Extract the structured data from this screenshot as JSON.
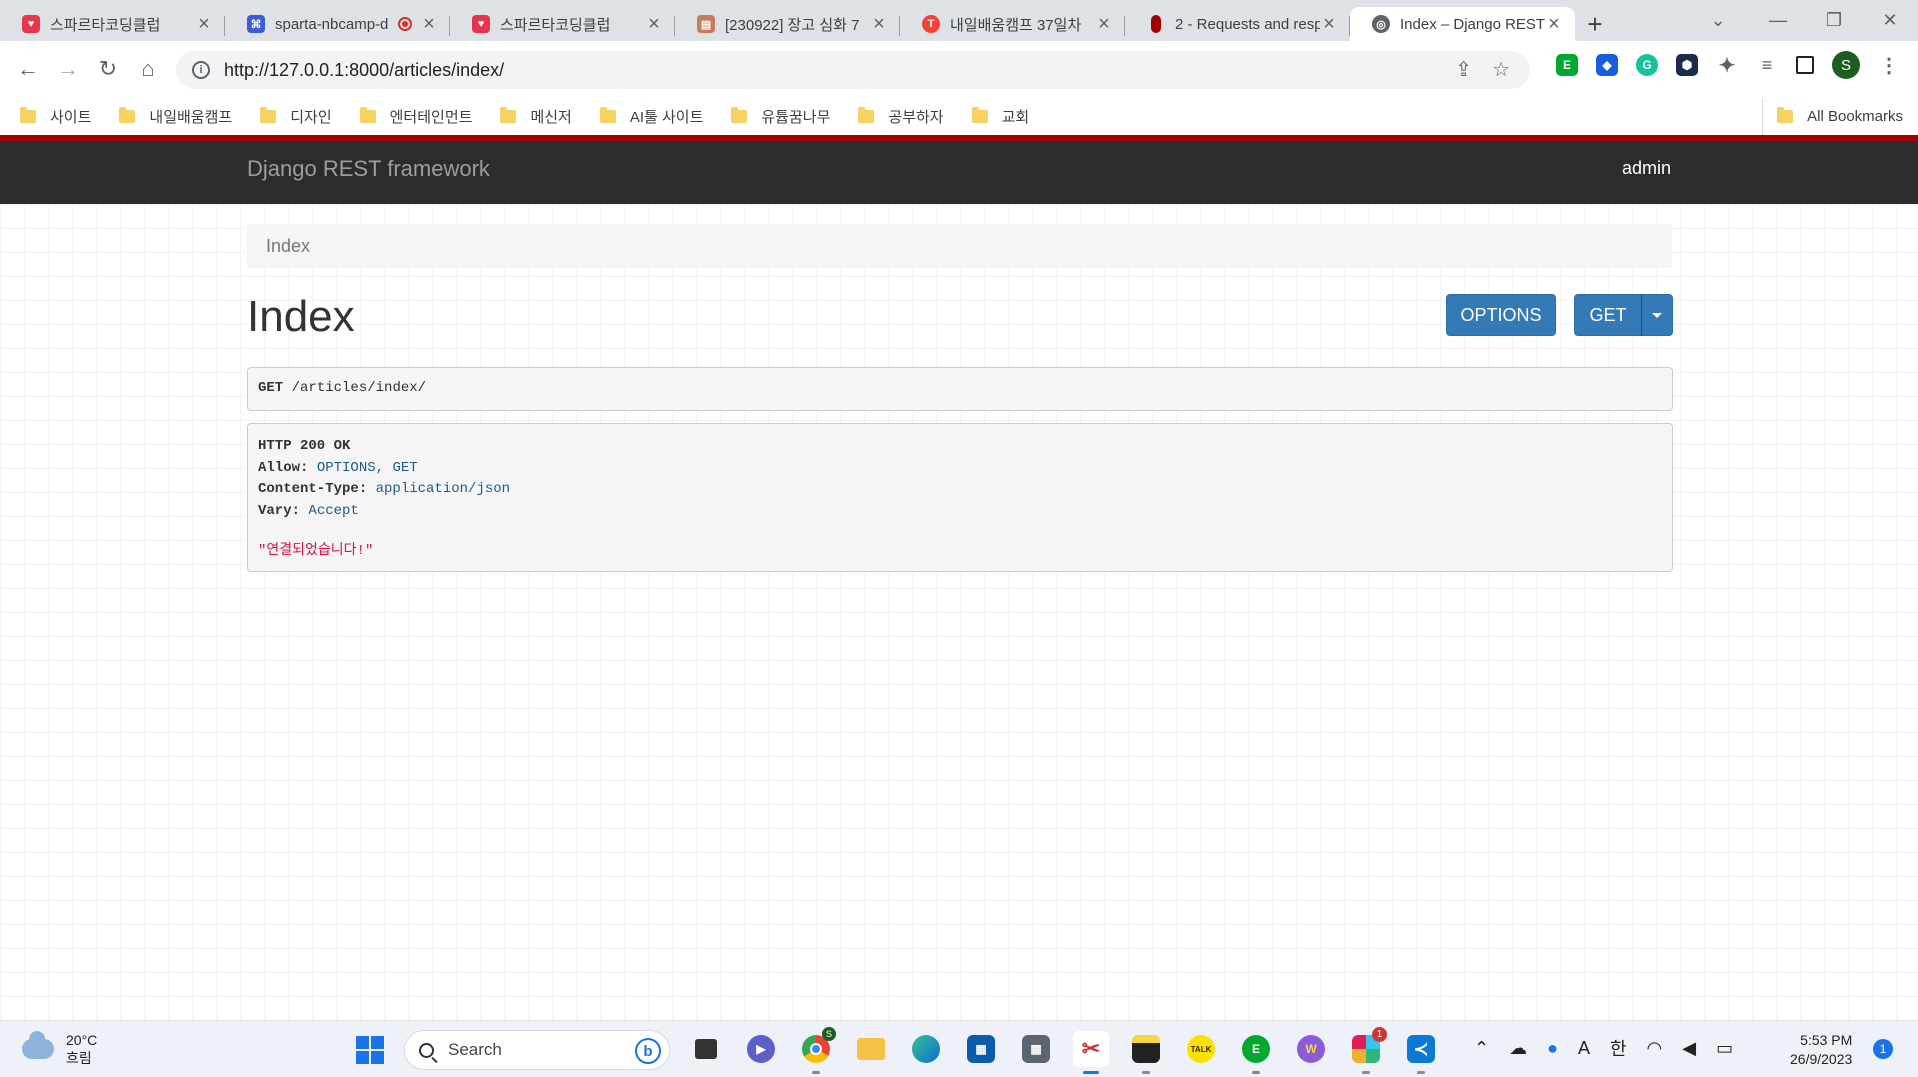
{
  "browser": {
    "tabs": [
      {
        "title": "스파르타코딩클럽",
        "favicon_color": "#e8344e",
        "active": false
      },
      {
        "title": "sparta-nbcamp-d",
        "favicon_color": "#3b5bdb",
        "active": false,
        "recording": true
      },
      {
        "title": "스파르타코딩클럽",
        "favicon_color": "#e8344e",
        "active": false
      },
      {
        "title": "[230922] 장고 심화 7",
        "favicon_color": "#c77b5a",
        "active": false
      },
      {
        "title": "내일배움캠프 37일차",
        "favicon_color": "#f44336",
        "active": false
      },
      {
        "title": "2 - Requests and resp",
        "favicon_color": "#a30000",
        "active": false
      },
      {
        "title": "Index – Django REST",
        "favicon_color": "#5f6368",
        "active": true
      }
    ],
    "new_tab_label": "+",
    "url": "http://127.0.0.1:8000/articles/index/",
    "profile_initial": "S",
    "bookmarks": [
      "사이트",
      "내일배움캠프",
      "디자인",
      "엔터테인먼트",
      "메신저",
      "AI툴 사이트",
      "유튭꿈나무",
      "공부하자",
      "교회"
    ],
    "all_bookmarks_label": "All Bookmarks"
  },
  "drf": {
    "brand": "Django REST framework",
    "user": "admin",
    "breadcrumb": "Index",
    "title": "Index",
    "options_label": "OPTIONS",
    "get_label": "GET",
    "request": {
      "method": "GET",
      "path": "/articles/index/"
    },
    "response": {
      "status": "HTTP 200 OK",
      "headers": [
        {
          "name": "Allow:",
          "value": "OPTIONS, GET"
        },
        {
          "name": "Content-Type:",
          "value": "application/json"
        },
        {
          "name": "Vary:",
          "value": "Accept"
        }
      ],
      "body": "\"연결되었습니다!\""
    },
    "accent_color": "#a30000",
    "button_color": "#337ab7"
  },
  "taskbar": {
    "weather_temp": "20°C",
    "weather_desc": "흐림",
    "search_placeholder": "Search",
    "time": "5:53 PM",
    "date": "26/9/2023",
    "notification_count": "1",
    "ime_label": "한",
    "font_label": "A",
    "slack_badge": "1",
    "chrome_badge": "S",
    "kakao_label": "TALK"
  }
}
